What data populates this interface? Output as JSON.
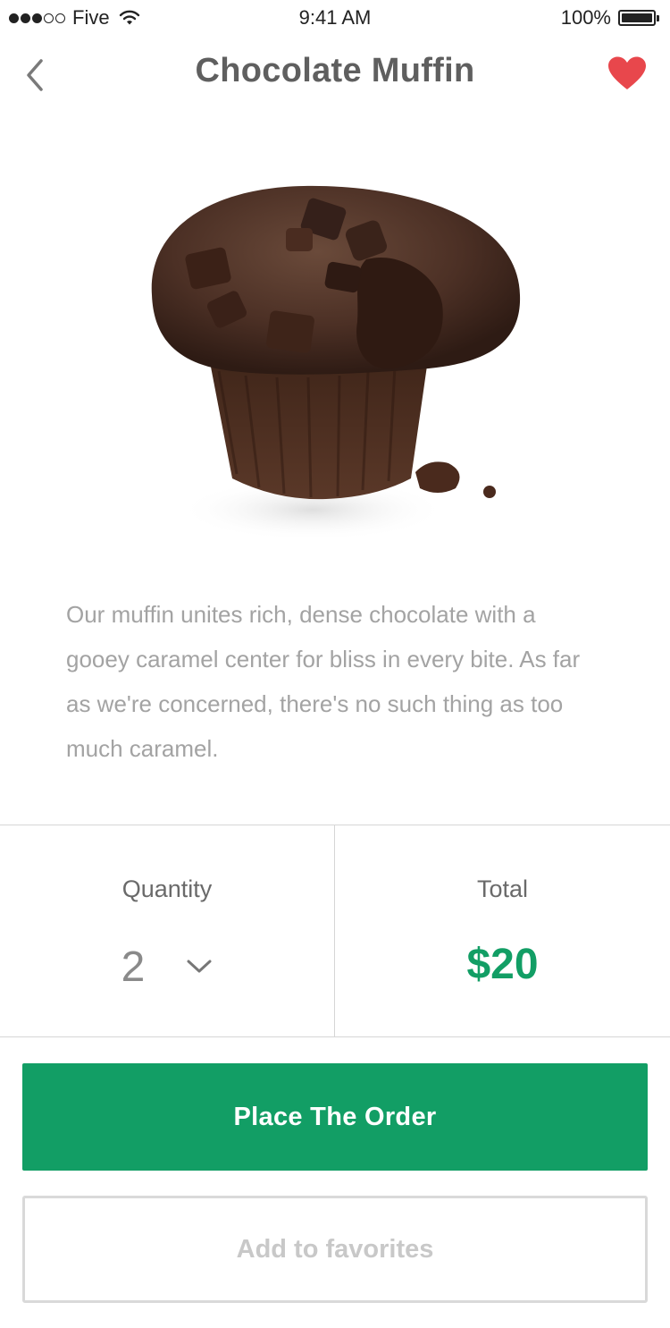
{
  "status_bar": {
    "carrier": "Five",
    "time": "9:41 AM",
    "battery_percent": "100%",
    "signal_bars_filled": 3,
    "signal_bars_total": 5
  },
  "header": {
    "title": "Chocolate Muffin",
    "back_icon": "chevron-left-icon",
    "favorite_icon": "heart-icon",
    "favorite_active": true
  },
  "product": {
    "description": "Our muffin unites rich, dense chocolate with a gooey caramel center for bliss in every bite. As far as we're concerned, there's no such thing as too much caramel."
  },
  "order": {
    "quantity_label": "Quantity",
    "quantity_value": "2",
    "total_label": "Total",
    "total_value": "$20"
  },
  "actions": {
    "place_order_label": "Place The Order",
    "add_favorites_label": "Add to favorites"
  },
  "colors": {
    "accent": "#129e65",
    "heart": "#e8474c",
    "text_muted": "#a3a3a3"
  }
}
